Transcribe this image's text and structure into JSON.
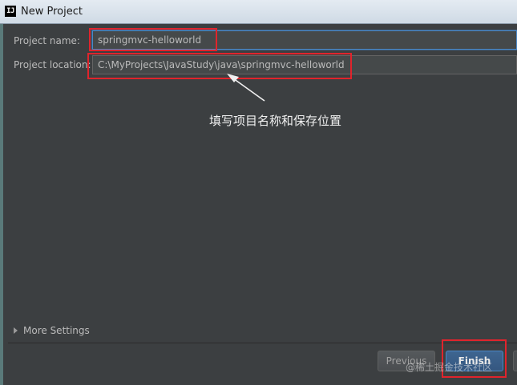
{
  "window": {
    "title": "New Project",
    "icon_text": "IJ",
    "icon": "intellij-idea-icon"
  },
  "form": {
    "project_name_label": "Project name:",
    "project_name_value": "springmvc-helloworld",
    "project_location_label": "Project location:",
    "project_location_value": "C:\\MyProjects\\JavaStudy\\java\\springmvc-helloworld"
  },
  "annotation": {
    "text": "填写项目名称和保存位置"
  },
  "more_settings": {
    "label": "More Settings",
    "icon": "expand-triangle-icon"
  },
  "buttons": {
    "previous": "Previous",
    "finish": "Finish"
  },
  "watermark": "@稀土掘金技术社区",
  "colors": {
    "background": "#3c3f41",
    "highlight_box": "#e0242c",
    "focus_border": "#4a88c7"
  }
}
